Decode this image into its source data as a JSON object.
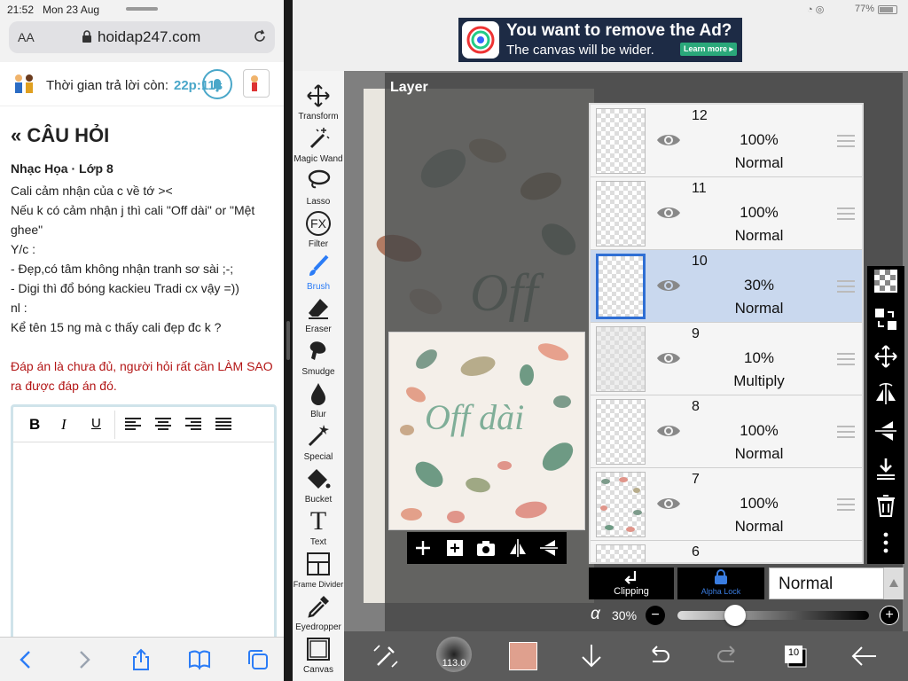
{
  "status": {
    "time": "21:52",
    "date": "Mon 23 Aug",
    "battery": "77%"
  },
  "browser": {
    "text_size": "AA",
    "url": "hoidap247.com",
    "timer_label": "Thời gian trả lời còn:",
    "timer_value": "22p:11s",
    "section_title": "CÂU HỎI",
    "subject": "Nhạc Họa · Lớp 8",
    "question_lines": [
      "Cali cảm nhận của c về tớ ><",
      "Nếu k có cảm nhận j thì cali \"Off dài\" or \"Mệt ghee\"",
      "Y/c :",
      "- Đẹp,có tâm không nhận tranh sơ sài ;-;",
      "- Digi thì đổ bóng kackieu Tradi cx vậy =))",
      "nl :",
      "Kể tên 15 ng mà c thấy cali đẹp đc k ?"
    ],
    "warning": "Đáp án là chưa đủ, người hỏi rất cần LÀM SAO ra được đáp án đó.",
    "editor": {
      "bold": "B",
      "italic": "I",
      "underline": "U"
    }
  },
  "ad": {
    "title": "You want to remove the Ad?",
    "subtitle": "The canvas will be wider.",
    "cta": "Learn more ▸"
  },
  "tools": [
    {
      "label": "Transform",
      "icon": "transform-icon"
    },
    {
      "label": "Magic Wand",
      "icon": "magic-wand-icon"
    },
    {
      "label": "Lasso",
      "icon": "lasso-icon"
    },
    {
      "label": "Filter",
      "icon": "filter-icon"
    },
    {
      "label": "Brush",
      "icon": "brush-icon"
    },
    {
      "label": "Eraser",
      "icon": "eraser-icon"
    },
    {
      "label": "Smudge",
      "icon": "smudge-icon"
    },
    {
      "label": "Blur",
      "icon": "blur-icon"
    },
    {
      "label": "Special",
      "icon": "special-icon"
    },
    {
      "label": "Bucket",
      "icon": "bucket-icon"
    },
    {
      "label": "Text",
      "icon": "text-icon"
    },
    {
      "label": "Frame Divider",
      "icon": "frame-divider-icon"
    },
    {
      "label": "Eyedropper",
      "icon": "eyedropper-icon"
    },
    {
      "label": "Canvas",
      "icon": "canvas-icon"
    }
  ],
  "filter_badge": "FX",
  "text_tool_glyph": "T",
  "layer_panel": {
    "title": "Layer",
    "layers": [
      {
        "num": "12",
        "opacity": "100%",
        "mode": "Normal",
        "selected": false
      },
      {
        "num": "11",
        "opacity": "100%",
        "mode": "Normal",
        "selected": false
      },
      {
        "num": "10",
        "opacity": "30%",
        "mode": "Normal",
        "selected": true
      },
      {
        "num": "9",
        "opacity": "10%",
        "mode": "Multiply",
        "selected": false
      },
      {
        "num": "8",
        "opacity": "100%",
        "mode": "Normal",
        "selected": false
      },
      {
        "num": "7",
        "opacity": "100%",
        "mode": "Normal",
        "selected": false
      },
      {
        "num": "6",
        "opacity": "",
        "mode": "",
        "selected": false
      }
    ],
    "clipping_label": "Clipping",
    "alpha_lock_label": "Alpha Lock",
    "blend_mode": "Normal",
    "alpha_symbol": "α",
    "opacity_value": "30%",
    "opacity_fraction": 0.3,
    "minus": "−",
    "plus": "+"
  },
  "preview": {
    "artwork_text": "Off dài"
  },
  "bottom": {
    "brush_size": "113.0",
    "color": "#dfa08e",
    "layer_count": "10"
  }
}
